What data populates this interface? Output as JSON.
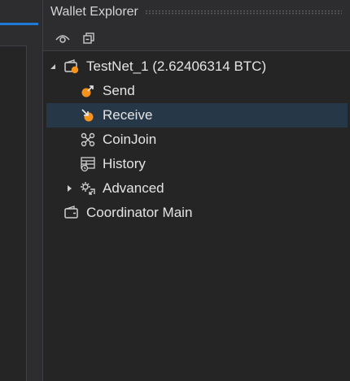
{
  "window": {
    "title": "Wallet Explorer"
  },
  "toolbar": [
    {
      "icon": "eye-icon",
      "tooltip": ""
    },
    {
      "icon": "collapse-all-icon",
      "tooltip": ""
    }
  ],
  "tree": {
    "wallet": {
      "label": "TestNet_1 (2.62406314 BTC)",
      "icon": "wallet-icon",
      "expanded": true
    },
    "children": [
      {
        "label": "Send",
        "icon": "send-icon"
      },
      {
        "label": "Receive",
        "icon": "receive-icon",
        "selected": true
      },
      {
        "label": "CoinJoin",
        "icon": "coinjoin-icon"
      },
      {
        "label": "History",
        "icon": "history-icon"
      },
      {
        "label": "Advanced",
        "icon": "advanced-icon",
        "expandable": true
      }
    ],
    "coordinator": {
      "label": "Coordinator Main",
      "icon": "wallet-icon"
    }
  },
  "colors": {
    "accent": "#f7931a",
    "selection": "#263848",
    "tab_accent": "#1e7ad6"
  }
}
